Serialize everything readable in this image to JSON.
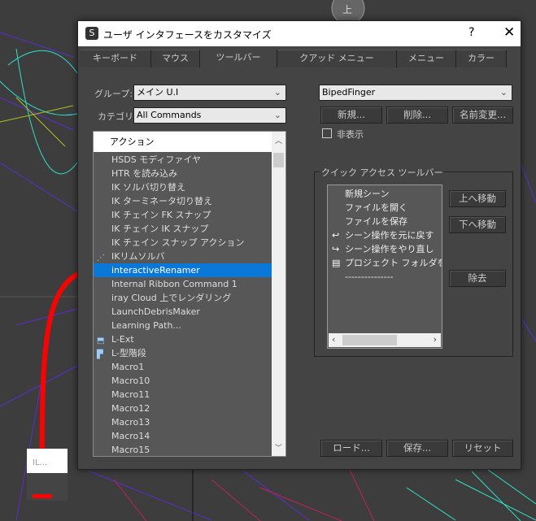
{
  "dialog": {
    "title": "ユーザ インタフェースをカスタマイズ",
    "help": "?",
    "close": "✕",
    "app_icon": "3ds-max-logo"
  },
  "tabs": [
    "キーボード",
    "マウス",
    "ツールバー",
    "クアッド メニュー",
    "メニュー",
    "カラー"
  ],
  "selected_tab": "ツールバー",
  "group": {
    "label": "グループ:",
    "value": "メイン U.I"
  },
  "category": {
    "label": "カテゴリ:",
    "value": "All Commands"
  },
  "toolbar_select": {
    "value": "BipedFinger"
  },
  "toolbar_buttons": {
    "new": "新規...",
    "delete": "削除...",
    "rename": "名前変更..."
  },
  "hide": {
    "label": "非表示",
    "checked": false
  },
  "actions": {
    "header": "アクション",
    "items": [
      "HSDS モディファイヤ",
      "HTR を読み込み",
      "IK ソルバ切り替え",
      "IK ターミネータ切り替え",
      "IK チェイン FK スナップ",
      "IK チェイン IK スナップ",
      "IK チェイン スナップ アクション",
      "IKリムソルバ",
      "interactiveRenamer",
      "Internal Ribbon Command 1",
      "iray Cloud 上でレンダリング",
      "LaunchDebrisMaker",
      "Learning Path...",
      "L-Ext",
      "L-型階段",
      "Macro1",
      "Macro10",
      "Macro11",
      "Macro12",
      "Macro13",
      "Macro14",
      "Macro15"
    ],
    "selected": "interactiveRenamer"
  },
  "quick_access": {
    "title": "クイック アクセス ツールバー",
    "items": [
      {
        "label": "新規シーン",
        "icon": ""
      },
      {
        "label": "ファイルを開く",
        "icon": ""
      },
      {
        "label": "ファイルを保存",
        "icon": ""
      },
      {
        "label": "シーン操作を元に戻す",
        "icon": "undo-icon"
      },
      {
        "label": "シーン操作をやり直し",
        "icon": "redo-icon"
      },
      {
        "label": "プロジェクト フォルダを設定",
        "icon": "folder-icon"
      },
      {
        "label": "---------------",
        "icon": ""
      }
    ],
    "move_up": "上へ移動",
    "move_down": "下へ移動",
    "remove": "除去"
  },
  "footer": {
    "load": "ロード...",
    "save": "保存...",
    "reset": "リセット"
  },
  "viewport": {
    "top_button": "上",
    "mini_popup": "IL..."
  }
}
